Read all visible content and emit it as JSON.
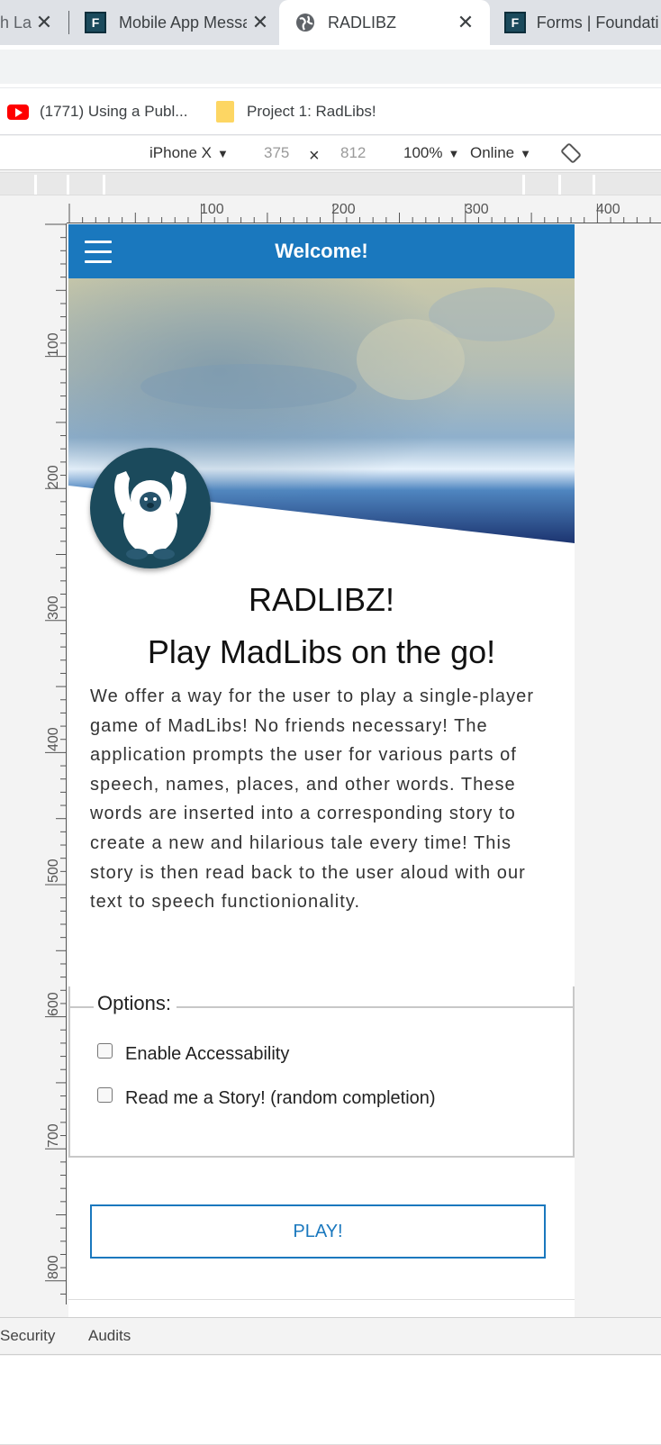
{
  "tabs": [
    {
      "title": "h Lal",
      "active": false
    },
    {
      "title": "Mobile App Messa",
      "active": false,
      "icon": "F"
    },
    {
      "title": "RADLIBZ",
      "active": true,
      "icon": "globe-icon"
    },
    {
      "title": "Forms | Foundati",
      "active": false,
      "icon": "F"
    }
  ],
  "bookmarks": [
    {
      "label": "(1771) Using a Publ...",
      "icon": "youtube-icon"
    },
    {
      "label": "Project 1: RadLibs!",
      "icon": "folder-icon"
    }
  ],
  "device_toolbar": {
    "device": "iPhone X",
    "width": "375",
    "times": "×",
    "height": "812",
    "zoom": "100%",
    "network": "Online"
  },
  "ruler": {
    "h_labels": [
      "100",
      "200",
      "300",
      "400"
    ],
    "v_labels": [
      "100",
      "200",
      "300",
      "400",
      "500",
      "600",
      "700",
      "800"
    ]
  },
  "app": {
    "header_title": "Welcome!",
    "title": "RADLIBZ!",
    "subtitle": "Play MadLibs on the go!",
    "description": "We offer a way for the user to play a single-player game of MadLibs! No friends necessary! The application prompts the user for various parts of speech, names, places, and other words. These words are inserted into a corresponding story to create a new and hilarious tale every time! This story is then read back to the user aloud with our text to speech functionionality.",
    "options_legend": "Options:",
    "options": [
      {
        "label": "Enable Accessability",
        "checked": false
      },
      {
        "label": "Read me a Story! (random completion)",
        "checked": false
      }
    ],
    "play_label": "PLAY!",
    "accent": "#1a78be"
  },
  "devtools_tabs": [
    "Security",
    "Audits"
  ]
}
